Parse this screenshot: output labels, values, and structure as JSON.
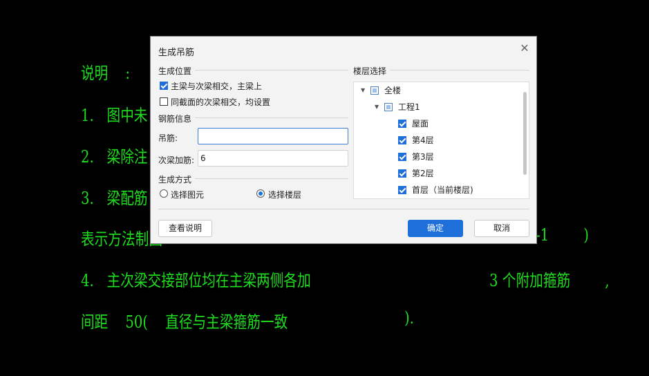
{
  "background_text": {
    "line1": "说明    :",
    "line2": "1.   图中未",
    "line3": "2.   梁除注",
    "line4": "3.   梁配筋",
    "line5": "表示方法制图",
    "line5_tail": "-1        )",
    "line6": "4.   主次梁交接部位均在主梁两侧各加",
    "line6_tail": "3 个附加箍筋        ,",
    "line7": "间距    50(    直径与主梁箍筋一致",
    "line7_tail": ")."
  },
  "dialog": {
    "title": "生成吊筋",
    "close_icon": "close-icon",
    "position_group": {
      "label": "生成位置",
      "option1": "主梁与次梁相交，主梁上",
      "option1_checked": true,
      "option2": "同截面的次梁相交，均设置",
      "option2_checked": false
    },
    "rebar_group": {
      "label": "钢筋信息",
      "hanger_label": "吊筋:",
      "hanger_value": "",
      "secondary_label": "次梁加筋:",
      "secondary_value": "6"
    },
    "method_group": {
      "label": "生成方式",
      "option1": "选择图元",
      "option2": "选择楼层",
      "selected": "选择楼层"
    },
    "floor_group": {
      "label": "楼层选择",
      "root": "全楼",
      "project": "工程1",
      "floors": [
        "屋面",
        "第4层",
        "第3层",
        "第2层",
        "首层（当前楼层)"
      ]
    },
    "buttons": {
      "help": "查看说明",
      "ok": "确定",
      "cancel": "取消"
    }
  },
  "colors": {
    "cad_green": "#1edc1e",
    "accent": "#1e6fd9"
  }
}
